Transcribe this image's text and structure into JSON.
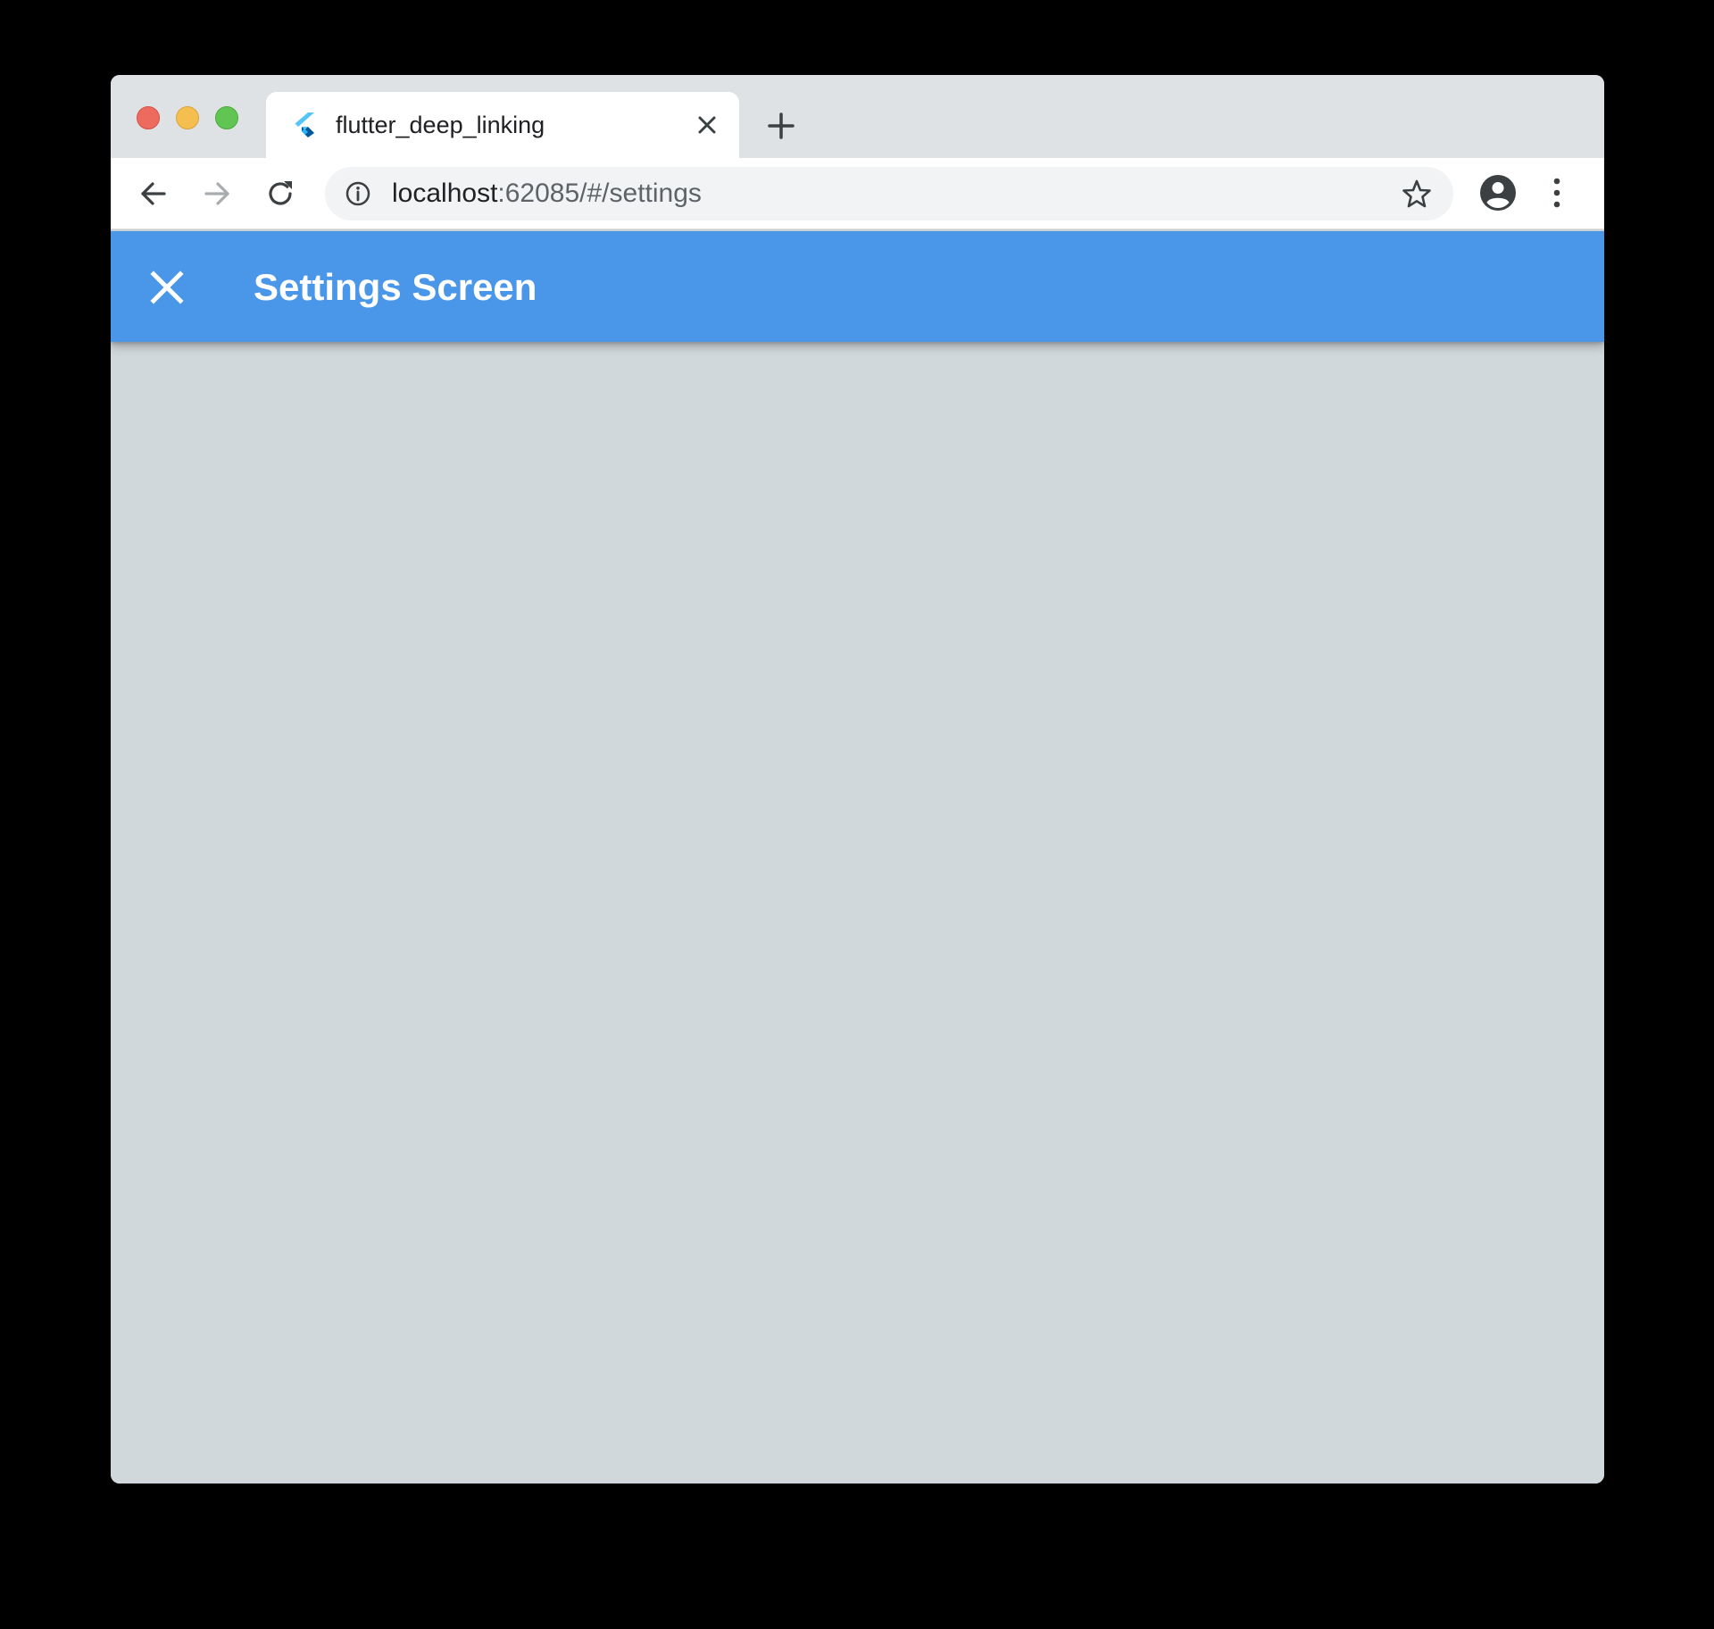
{
  "browser": {
    "tab": {
      "title": "flutter_deep_linking",
      "favicon": "flutter-logo-icon"
    },
    "address": {
      "host": "localhost",
      "rest": ":62085/#/settings"
    },
    "icons": {
      "back": "arrow-left-icon",
      "forward": "arrow-right-icon",
      "reload": "reload-icon",
      "info": "info-icon",
      "star": "star-icon",
      "profile": "account-circle-icon",
      "menu": "more-vert-icon",
      "tab_close": "close-icon",
      "new_tab": "plus-icon"
    }
  },
  "app": {
    "title": "Settings Screen",
    "close_icon": "close-icon",
    "colors": {
      "appbar": "#4a97ea",
      "background": "#d0d8dc"
    }
  }
}
